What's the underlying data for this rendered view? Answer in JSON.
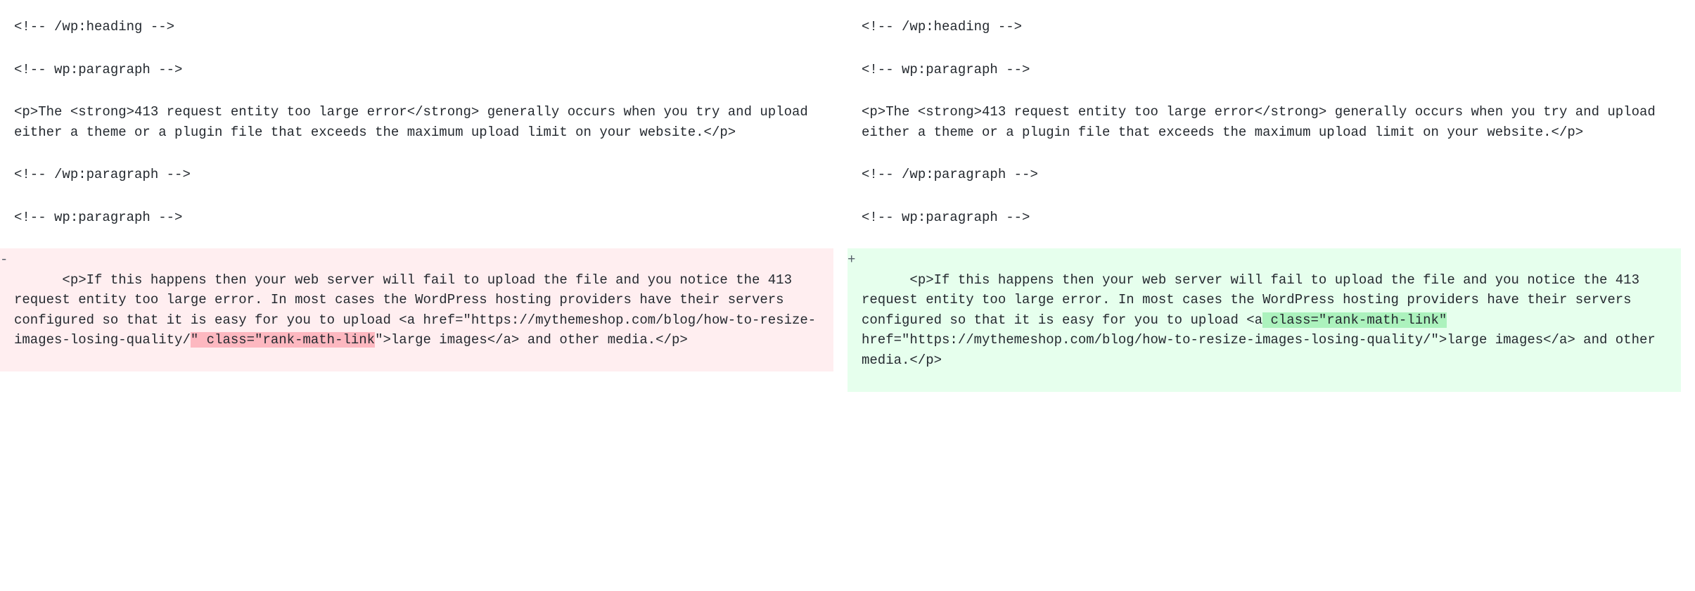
{
  "left": {
    "marker": "-",
    "context": [
      "<!-- /wp:heading -->",
      "",
      "<!-- wp:paragraph -->",
      "",
      "<p>The <strong>413 request entity too large error</strong> generally occurs when you try and upload either a theme or a plugin file that exceeds the maximum upload limit on your website.</p>",
      "",
      "<!-- /wp:paragraph -->",
      "",
      "<!-- wp:paragraph -->",
      ""
    ],
    "changed_prefix": "<p>If this happens then your web server will fail to upload the file and you notice the 413 request entity too large error. In most cases the WordPress hosting providers have their servers configured so that it is easy for you to upload <a href=\"https://mythemeshop.com/blog/how-to-resize-images-losing-quality/",
    "changed_highlight": "\" class=\"rank-math-link",
    "changed_suffix": "\">large images</a> and other media.</p>"
  },
  "right": {
    "marker": "+",
    "context": [
      "<!-- /wp:heading -->",
      "",
      "<!-- wp:paragraph -->",
      "",
      "<p>The <strong>413 request entity too large error</strong> generally occurs when you try and upload either a theme or a plugin file that exceeds the maximum upload limit on your website.</p>",
      "",
      "<!-- /wp:paragraph -->",
      "",
      "<!-- wp:paragraph -->",
      ""
    ],
    "changed_prefix": "<p>If this happens then your web server will fail to upload the file and you notice the 413 request entity too large error. In most cases the WordPress hosting providers have their servers configured so that it is easy for you to upload <a",
    "changed_highlight": " class=\"rank-math-link\"",
    "changed_suffix": " href=\"https://mythemeshop.com/blog/how-to-resize-images-losing-quality/\">large images</a> and other media.</p>"
  }
}
